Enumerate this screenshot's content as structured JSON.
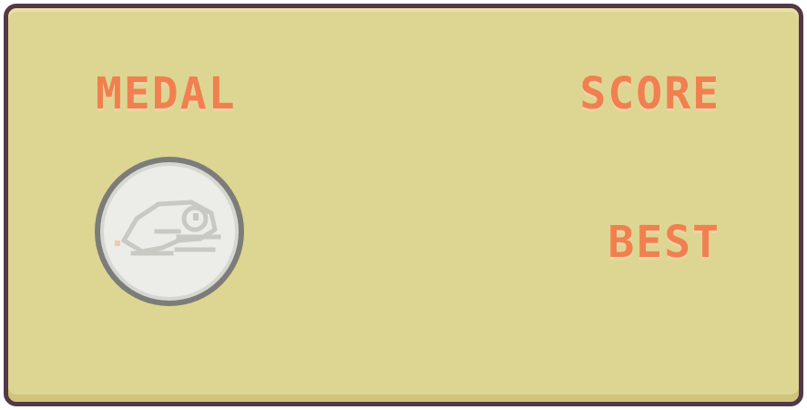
{
  "scoreboard": {
    "medal_label": "MEDAL",
    "score_label": "SCORE",
    "best_label": "BEST"
  },
  "medal": {
    "icon": "bird-medal-icon",
    "tier": "silver"
  },
  "colors": {
    "panel_background": "#ddd692",
    "panel_border": "#543847",
    "label_text": "#f08050",
    "medal_face": "#e9e9e6",
    "medal_rim": "#7c7c78"
  }
}
